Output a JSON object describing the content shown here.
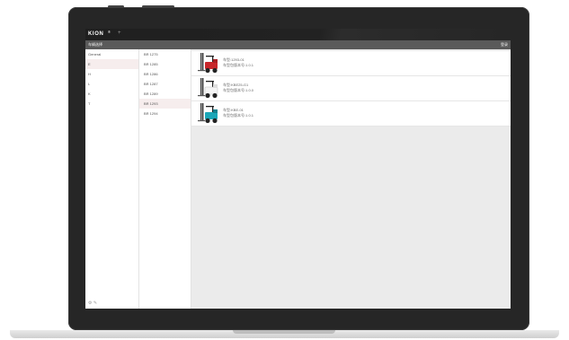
{
  "app": {
    "logo": "KION",
    "logo_mark": "®",
    "tab_plus": "+",
    "title": "车辆选择",
    "title_action": "登录"
  },
  "categories": [
    {
      "label": "General",
      "active": false
    },
    {
      "label": "E",
      "active": true
    },
    {
      "label": "H",
      "active": false
    },
    {
      "label": "L",
      "active": false
    },
    {
      "label": "K",
      "active": false
    },
    {
      "label": "T",
      "active": false
    }
  ],
  "footer_icons": "⚙ ✎",
  "models": [
    {
      "label": "BR 1275",
      "active": false
    },
    {
      "label": "BR 1285",
      "active": false
    },
    {
      "label": "BR 1286",
      "active": false
    },
    {
      "label": "BR 1287",
      "active": false
    },
    {
      "label": "BR 1289",
      "active": false
    },
    {
      "label": "BR 1293",
      "active": true
    },
    {
      "label": "BR 1294",
      "active": false
    }
  ],
  "vehicles": [
    {
      "name": "车型:1293-01",
      "version": "车型包版本号:1.0.1",
      "body_color": "#c8262a",
      "icon": "forklift-red-icon"
    },
    {
      "name": "车型:KBE25-G1",
      "version": "车型包版本号:1.0.0",
      "body_color": "#ffffff",
      "icon": "forklift-white-icon"
    },
    {
      "name": "车型:KBE-01",
      "version": "车型包版本号:1.0.1",
      "body_color": "#1aa6b7",
      "icon": "forklift-teal-icon"
    }
  ],
  "colors": {
    "app_bar": "#222222",
    "title_bar": "#5a5a5a",
    "selection": "#f6eded",
    "content_bg": "#ebebeb"
  }
}
